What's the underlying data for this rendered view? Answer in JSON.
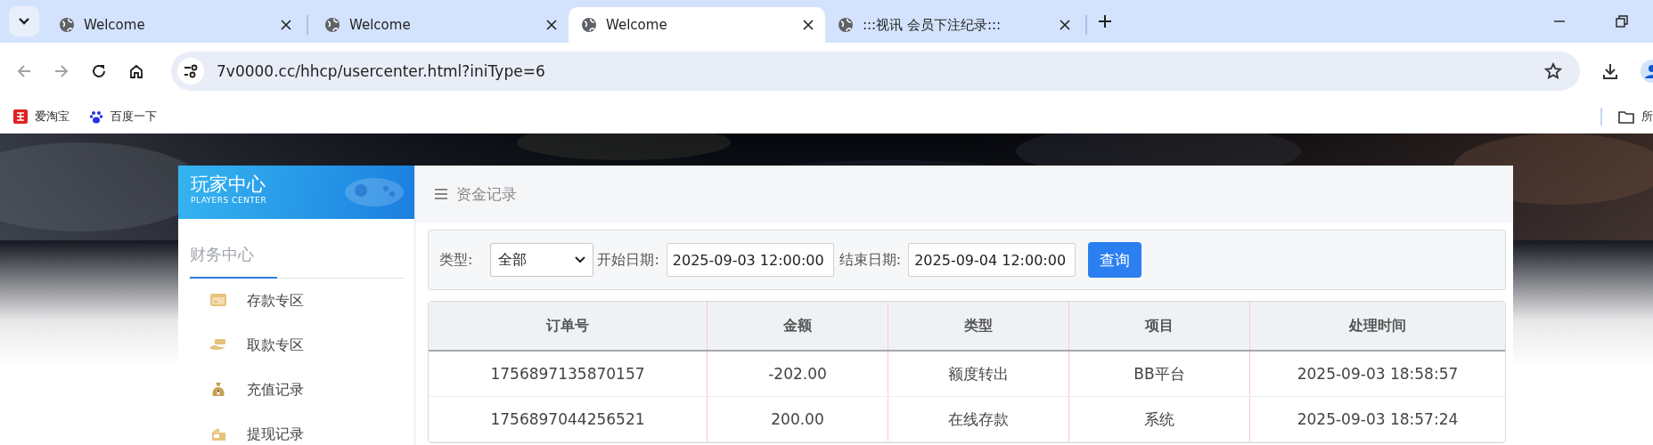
{
  "browser": {
    "tabs": [
      {
        "title": "Welcome",
        "selected": false
      },
      {
        "title": "Welcome",
        "selected": false
      },
      {
        "title": "Welcome",
        "selected": true
      },
      {
        "title": ":::视讯 会员下注纪录:::",
        "selected": false
      }
    ],
    "url": "7v0000.cc/hhcp/usercenter.html?iniType=6",
    "bookmarks": [
      {
        "label": "爱淘宝"
      },
      {
        "label": "百度一下"
      }
    ],
    "bookmark_folder": "所"
  },
  "sidebar": {
    "logo_title": "玩家中心",
    "logo_subtitle": "PLAYERS CENTER",
    "section": "财务中心",
    "items": [
      {
        "label": "存款专区"
      },
      {
        "label": "取款专区"
      },
      {
        "label": "充值记录"
      },
      {
        "label": "提现记录"
      }
    ]
  },
  "main": {
    "breadcrumb": "资金记录",
    "filter": {
      "type_label": "类型:",
      "type_value": "全部",
      "start_label": "开始日期:",
      "start_value": "2025-09-03 12:00:00",
      "end_label": "结束日期:",
      "end_value": "2025-09-04 12:00:00",
      "button": "查询"
    },
    "table": {
      "columns": [
        "订单号",
        "金额",
        "类型",
        "项目",
        "处理时间"
      ],
      "rows": [
        [
          "1756897135870157",
          "-202.00",
          "额度转出",
          "BB平台",
          "2025-09-03 18:58:57"
        ],
        [
          "1756897044256521",
          "200.00",
          "在线存款",
          "系统",
          "2025-09-03 18:57:24"
        ]
      ]
    }
  }
}
